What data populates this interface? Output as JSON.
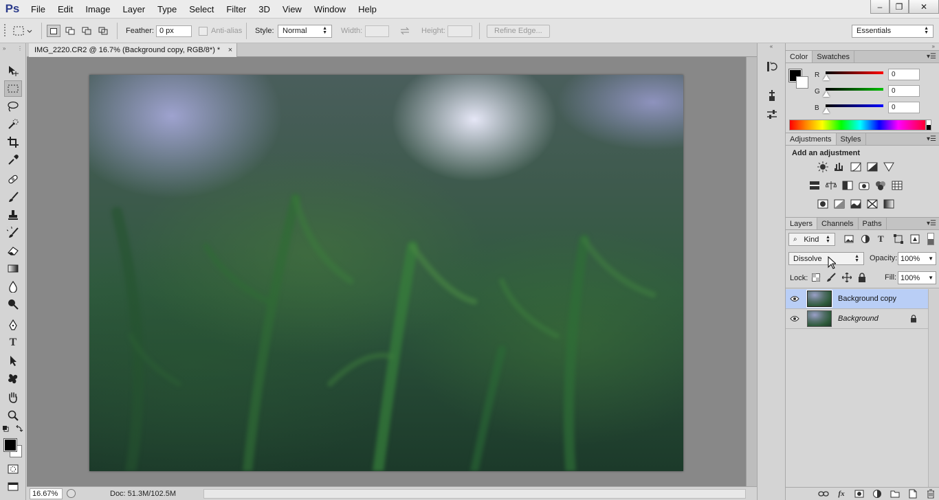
{
  "app": {
    "logo": "Ps",
    "menu": [
      "File",
      "Edit",
      "Image",
      "Layer",
      "Type",
      "Select",
      "Filter",
      "3D",
      "View",
      "Window",
      "Help"
    ]
  },
  "window_controls": {
    "minimize": "–",
    "restore": "❐",
    "close": "✕"
  },
  "options_bar": {
    "feather_label": "Feather:",
    "feather_value": "0 px",
    "antialias_label": "Anti-alias",
    "style_label": "Style:",
    "style_value": "Normal",
    "width_label": "Width:",
    "height_label": "Height:",
    "refine_edge_label": "Refine Edge...",
    "workspace": "Essentials"
  },
  "document": {
    "tab_title": "IMG_2220.CR2 @ 16.7% (Background copy, RGB/8*) *",
    "tab_close": "×",
    "zoom": "16.67%",
    "doc_info": "Doc: 51.3M/102.5M"
  },
  "color_panel": {
    "tabs": [
      "Color",
      "Swatches"
    ],
    "channels": [
      {
        "label": "R",
        "value": "0",
        "color": "#ff0000"
      },
      {
        "label": "G",
        "value": "0",
        "color": "#00c000"
      },
      {
        "label": "B",
        "value": "0",
        "color": "#0000ff"
      }
    ]
  },
  "adjustments_panel": {
    "tabs": [
      "Adjustments",
      "Styles"
    ],
    "title": "Add an adjustment"
  },
  "layers_panel": {
    "tabs": [
      "Layers",
      "Channels",
      "Paths"
    ],
    "filter_kind": "Kind",
    "blend_mode": "Dissolve",
    "opacity_label": "Opacity:",
    "opacity_value": "100%",
    "lock_label": "Lock:",
    "fill_label": "Fill:",
    "fill_value": "100%",
    "layers": [
      {
        "name": "Background copy",
        "selected": true,
        "locked": false,
        "italic": false
      },
      {
        "name": "Background",
        "selected": false,
        "locked": true,
        "italic": true
      }
    ],
    "bottom_icons": [
      "link-icon",
      "fx-icon",
      "mask-icon",
      "adjustment-layer-icon",
      "group-icon",
      "new-layer-icon",
      "trash-icon"
    ]
  }
}
